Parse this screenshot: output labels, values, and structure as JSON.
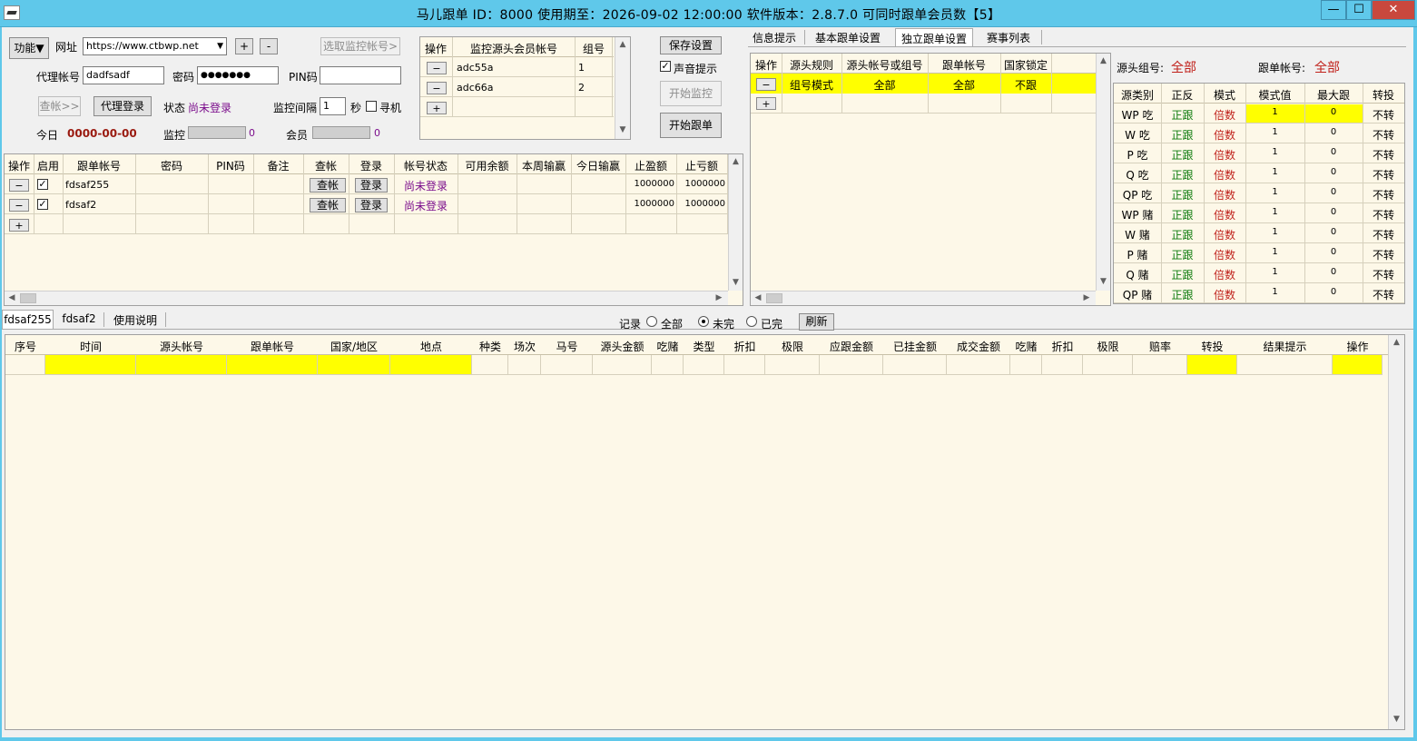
{
  "window": {
    "title": "马儿跟单 ID：8000 使用期至：2026-09-02 12:00:00 软件版本：2.8.7.0 可同时跟单会员数【5】",
    "minimize": "—",
    "maximize": "☐",
    "close": "✕"
  },
  "top": {
    "func_button": "功能▼",
    "url_label": "网址",
    "url_value": "https://www.ctbwp.net",
    "plus": "+",
    "minus": "-",
    "select_monitor": "选取监控帐号>",
    "agent_label": "代理帐号",
    "agent_value": "dadfsadf",
    "pwd_label": "密码",
    "pwd_value": "●●●●●●●",
    "pin_label": "PIN码",
    "pin_value": "",
    "check_btn": "查帐>>",
    "agent_login_btn": "代理登录",
    "status_label": "状态",
    "status_value": "尚未登录",
    "interval_label": "监控间隔",
    "interval_value": "1",
    "sec_label": "秒",
    "seek_label": "寻机",
    "today_label": "今日",
    "today_value": "0000-00-00",
    "monitor_label": "监控",
    "monitor_count": "0",
    "member_label": "会员",
    "member_count": "0"
  },
  "source_grid": {
    "headers": [
      "操作",
      "监控源头会员帐号",
      "组号"
    ],
    "rows": [
      {
        "op": "−",
        "account": "adc55a",
        "group": "1"
      },
      {
        "op": "−",
        "account": "adc66a",
        "group": "2"
      }
    ],
    "add": "+"
  },
  "right_buttons": {
    "save": "保存设置",
    "sound_label": "声音提示",
    "sound_checked": "✓",
    "start_monitor": "开始监控",
    "start_follow": "开始跟单"
  },
  "accounts_grid": {
    "headers": [
      "操作",
      "启用",
      "跟单帐号",
      "密码",
      "PIN码",
      "备注",
      "查帐",
      "登录",
      "帐号状态",
      "可用余额",
      "本周输赢",
      "今日输赢",
      "止盈额",
      "止亏额"
    ],
    "rows": [
      {
        "op": "−",
        "enabled": "✓",
        "account": "fdsaf255",
        "check": "查帐",
        "login": "登录",
        "status": "尚未登录",
        "take_profit": "1000000",
        "stop_loss": "1000000"
      },
      {
        "op": "−",
        "enabled": "✓",
        "account": "fdsaf2",
        "check": "查帐",
        "login": "登录",
        "status": "尚未登录",
        "take_profit": "1000000",
        "stop_loss": "1000000"
      }
    ],
    "add": "+"
  },
  "settings_tabs": [
    "信息提示",
    "基本跟单设置",
    "独立跟单设置",
    "赛事列表"
  ],
  "rule_grid": {
    "headers": [
      "操作",
      "源头规则",
      "源头帐号或组号",
      "跟单帐号",
      "国家锁定"
    ],
    "rows": [
      {
        "op": "−",
        "rule": "组号模式",
        "source": "全部",
        "follow": "全部",
        "country": "不跟"
      }
    ],
    "add": "+"
  },
  "filters": {
    "source_group_label": "源头组号:",
    "source_group_value": "全部",
    "follow_account_label": "跟单帐号:",
    "follow_account_value": "全部"
  },
  "type_grid": {
    "headers": [
      "源类别",
      "正反",
      "模式",
      "模式值",
      "最大跟",
      "转投"
    ],
    "rows": [
      {
        "type": "WP 吃",
        "dir": "正跟",
        "mode": "倍数",
        "val": "1",
        "max": "0",
        "switch": "不转"
      },
      {
        "type": "W 吃",
        "dir": "正跟",
        "mode": "倍数",
        "val": "1",
        "max": "0",
        "switch": "不转"
      },
      {
        "type": "P 吃",
        "dir": "正跟",
        "mode": "倍数",
        "val": "1",
        "max": "0",
        "switch": "不转"
      },
      {
        "type": "Q 吃",
        "dir": "正跟",
        "mode": "倍数",
        "val": "1",
        "max": "0",
        "switch": "不转"
      },
      {
        "type": "QP 吃",
        "dir": "正跟",
        "mode": "倍数",
        "val": "1",
        "max": "0",
        "switch": "不转"
      },
      {
        "type": "WP 赌",
        "dir": "正跟",
        "mode": "倍数",
        "val": "1",
        "max": "0",
        "switch": "不转"
      },
      {
        "type": "W 赌",
        "dir": "正跟",
        "mode": "倍数",
        "val": "1",
        "max": "0",
        "switch": "不转"
      },
      {
        "type": "P 赌",
        "dir": "正跟",
        "mode": "倍数",
        "val": "1",
        "max": "0",
        "switch": "不转"
      },
      {
        "type": "Q 赌",
        "dir": "正跟",
        "mode": "倍数",
        "val": "1",
        "max": "0",
        "switch": "不转"
      },
      {
        "type": "QP 赌",
        "dir": "正跟",
        "mode": "倍数",
        "val": "1",
        "max": "0",
        "switch": "不转"
      }
    ]
  },
  "bottom_tabs": [
    "fdsaf255",
    "fdsaf2",
    "使用说明"
  ],
  "records": {
    "label": "记录",
    "all": "全部",
    "pending": "未完",
    "done": "已完",
    "selected": "未完",
    "refresh": "刷新"
  },
  "log_grid": {
    "headers": [
      "序号",
      "时间",
      "源头帐号",
      "跟单帐号",
      "国家/地区",
      "地点",
      "种类",
      "场次",
      "马号",
      "源头金额",
      "吃赌",
      "类型",
      "折扣",
      "极限",
      "应跟金额",
      "已挂金额",
      "成交金额",
      "吃赌",
      "折扣",
      "极限",
      "赔率",
      "转投",
      "结果提示",
      "操作"
    ]
  },
  "colors": {
    "titlebar": "#5fc8ea",
    "cream": "#fdf8e8",
    "highlight": "#ffff00",
    "status_purple": "#7b0d8c",
    "positive_green": "#0b7a0b",
    "multiplier_red": "#c0201a"
  },
  "scroll": {
    "up": "▲",
    "down": "▼",
    "left": "◀",
    "right": "▶"
  }
}
